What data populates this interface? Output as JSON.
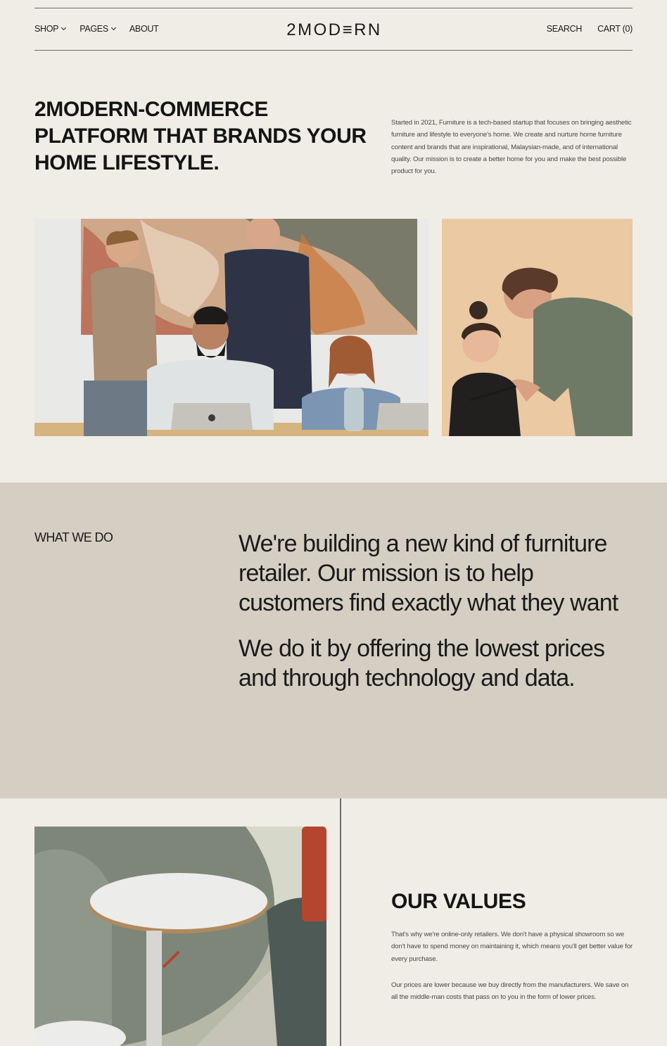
{
  "header": {
    "nav_left": [
      {
        "label": "SHOP",
        "has_dropdown": true
      },
      {
        "label": "PAGES",
        "has_dropdown": true
      },
      {
        "label": "ABOUT",
        "has_dropdown": false
      }
    ],
    "logo": "2MOD≡RN",
    "search_label": "SEARCH",
    "cart_label": "CART (0)"
  },
  "hero": {
    "title": "2MODERN-COMMERCE PLATFORM THAT BRANDS YOUR HOME LIFESTYLE.",
    "description": "Started in 2021, Furniture is a tech-based startup that focuses on bringing aesthetic furniture and lifestyle to everyone's home. We create and nurture home furniture content and brands that are inspirational, Malaysian-made, and of international quality. Our mission is to create a better home for you and make the best possible product for you."
  },
  "what_we_do": {
    "label": "WHAT WE DO",
    "paragraphs": [
      "We're building a new kind of furniture retailer. Our mission is to help customers find exactly what they want",
      "We do it by offering the lowest prices and through technology and data."
    ]
  },
  "values": {
    "title": "OUR VALUES",
    "paragraphs": [
      "That's why we're online-only retailers. We don't have a physical showroom so we don't have to spend money on maintaining it, which means you'll get better value for every purchase.",
      "Our prices are lower because we buy directly from the manufacturers. We save on all the middle-man costs that pass on to you in the form of lower prices."
    ]
  },
  "colors": {
    "background": "#f0ede6",
    "section_beige": "#d5cfc3",
    "text_dark": "#1a1a1a",
    "text_muted": "#4a4844"
  }
}
